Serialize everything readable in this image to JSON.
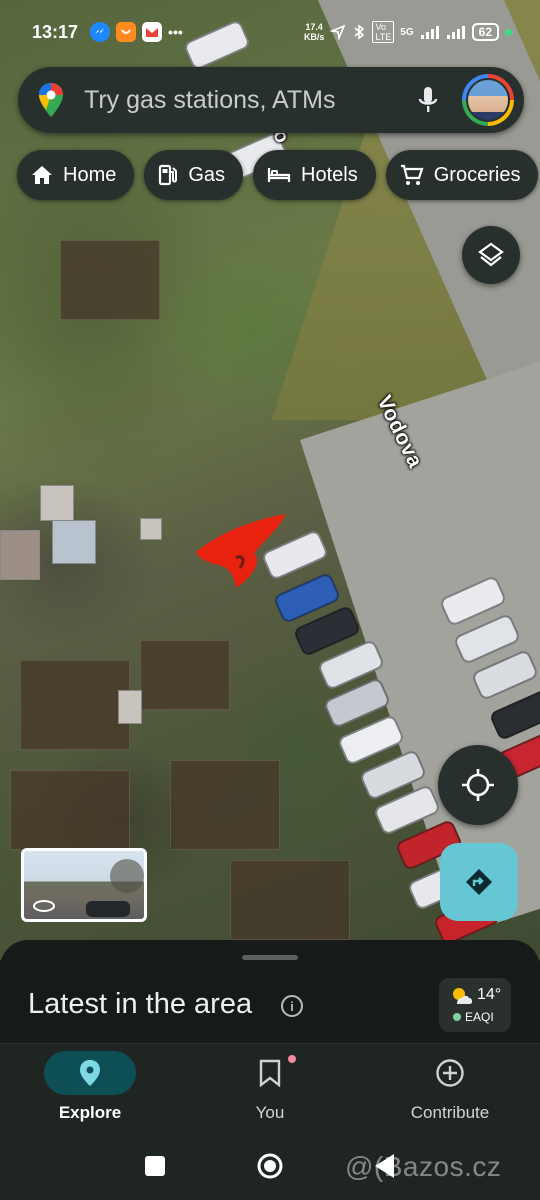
{
  "status_bar": {
    "time": "13:17",
    "net_speed_value": "17.4",
    "net_speed_unit": "KB/s",
    "network": "5G",
    "battery": "62"
  },
  "search": {
    "placeholder": "Try gas stations, ATMs"
  },
  "chips": [
    {
      "label": "Home",
      "icon": "home-icon"
    },
    {
      "label": "Gas",
      "icon": "gas-pump-icon"
    },
    {
      "label": "Hotels",
      "icon": "bed-icon"
    },
    {
      "label": "Groceries",
      "icon": "cart-icon"
    }
  ],
  "map": {
    "street_label": "Vodova",
    "street_label_partial": "o"
  },
  "bottom_sheet": {
    "title": "Latest in the area",
    "weather": {
      "temperature": "14°",
      "aqi_label": "EAQI"
    }
  },
  "nav": {
    "items": [
      {
        "label": "Explore",
        "icon": "pin-icon",
        "active": true
      },
      {
        "label": "You",
        "icon": "bookmark-icon",
        "active": false
      },
      {
        "label": "Contribute",
        "icon": "add-circle-icon",
        "active": false
      }
    ]
  },
  "watermark": "@(Bazos.cz",
  "colors": {
    "surface": "#27302d",
    "active_pill": "#0e4f55",
    "directions": "#64c7d3",
    "red_annotation": "#e8220f"
  }
}
